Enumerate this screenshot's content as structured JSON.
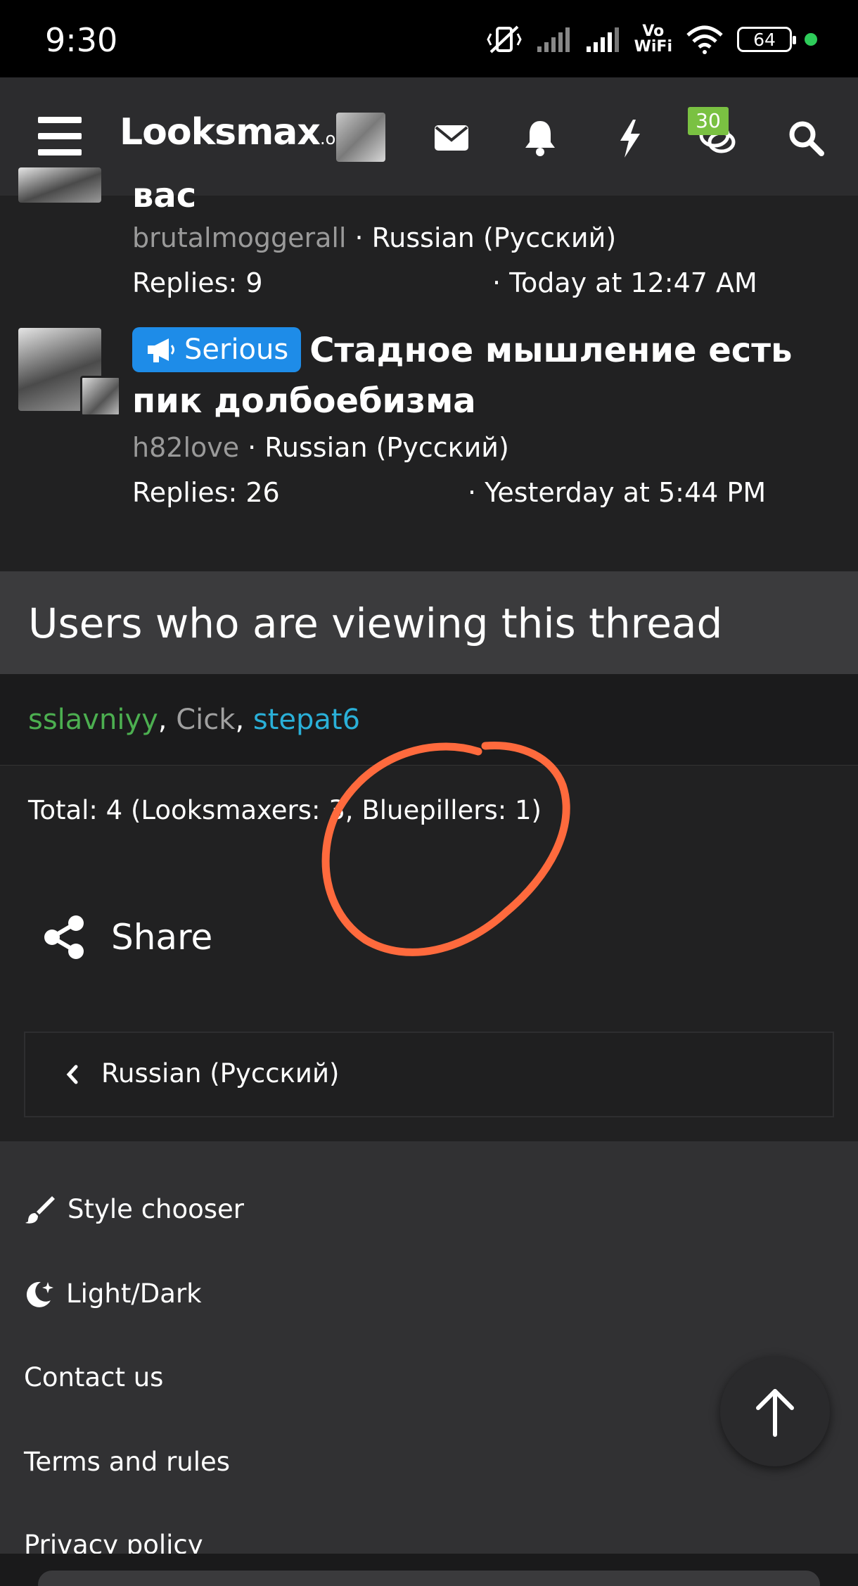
{
  "status_bar": {
    "time": "9:30",
    "vowifi_top": "Vo",
    "vowifi_bottom": "WiFi",
    "battery": "64",
    "icons": [
      "mute-vibrate-icon",
      "signal-icon",
      "signal-icon",
      "wifi-icon",
      "battery-icon",
      "dot-icon"
    ]
  },
  "header": {
    "logo_main": "Looksmax",
    "logo_suffix": ".org",
    "badge_count": "30",
    "icons": [
      "menu-icon",
      "avatar",
      "mail-icon",
      "bell-icon",
      "lightning-icon",
      "chat-icon",
      "search-icon"
    ]
  },
  "threads": [
    {
      "title_fragment": "вас",
      "author": "brutalmoggerall",
      "forum": "Russian (Русский)",
      "replies": "Replies: 9",
      "date": "Today at 12:47 AM"
    },
    {
      "prefix": "Serious",
      "title": "Стадное мышление есть пик долбоебизма",
      "author": "h82love",
      "forum": "Russian (Русский)",
      "replies": "Replies: 26",
      "date": "Yesterday at 5:44 PM"
    }
  ],
  "viewing": {
    "heading": "Users who are viewing this thread",
    "users": [
      "sslavniyy",
      "Cick",
      "stepat6"
    ],
    "separator": ", ",
    "total": "Total: 4 (Looksmaxers: 3, Bluepillers: 1)"
  },
  "share": {
    "label": "Share"
  },
  "breadcrumb": {
    "label": "Russian (Русский)"
  },
  "footer": {
    "style_chooser": "Style chooser",
    "light_dark": "Light/Dark",
    "contact": "Contact us",
    "terms": "Terms and rules",
    "privacy": "Privacy policy"
  },
  "colors": {
    "accent_prefix": "#1e8ce8",
    "badge": "#7ac142",
    "annotation": "#ff6a3d",
    "user_green": "#4caf50",
    "user_blue": "#2ab0d8"
  }
}
